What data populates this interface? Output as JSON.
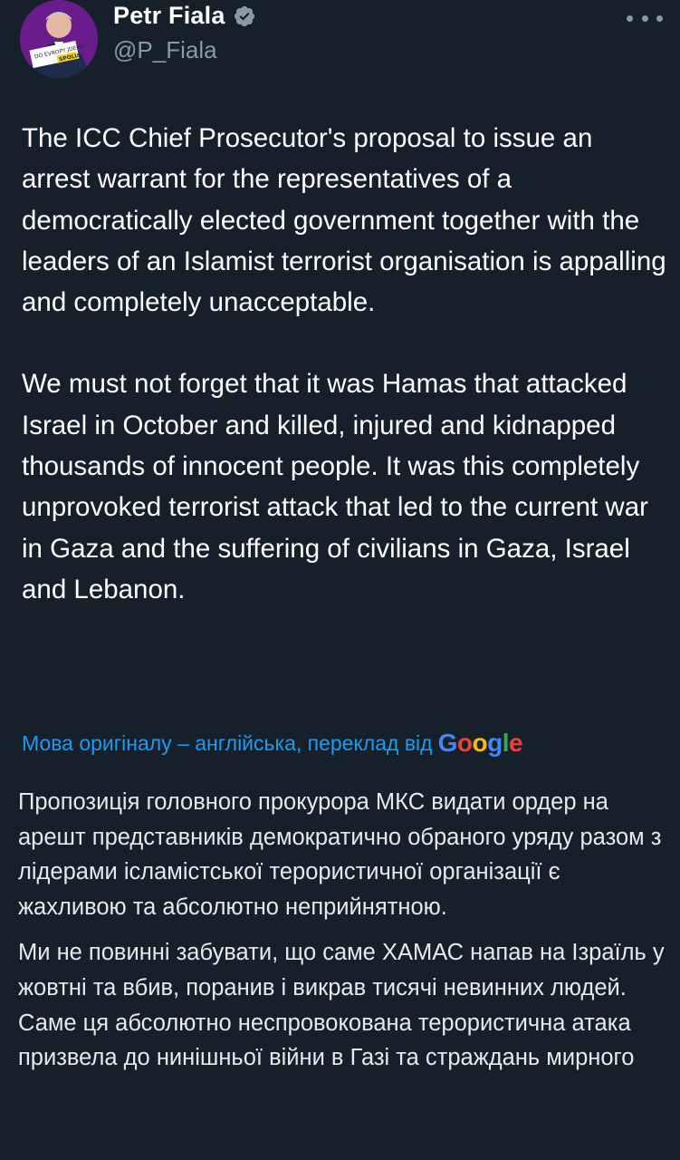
{
  "author": {
    "name": "Petr Fiala",
    "handle": "@P_Fiala",
    "verified": true,
    "avatar_badge_line1": "DO EVROPY JDEME",
    "avatar_badge_line2": "SPOLU"
  },
  "tweet": {
    "paragraph1": "The ICC Chief Prosecutor's proposal to issue an arrest warrant for the representatives of a democratically elected government together with the leaders of an Islamist terrorist organisation is appalling and completely unacceptable.",
    "paragraph2": "We must not forget that it was Hamas that attacked Israel in October and killed, injured and kidnapped thousands of innocent people. It was this completely unprovoked terrorist attack that led to the current war in Gaza and the suffering of civilians in Gaza, Israel and Lebanon."
  },
  "translation": {
    "notice": "Мова оригіналу – англійська, переклад від",
    "provider": "Google",
    "paragraph1": "Пропозиція головного прокурора МКС видати ордер на арешт представників демократично обраного уряду разом з лідерами ісламістської терористичної організації є жахливою та абсолютно неприйнятною.",
    "paragraph2": "Ми не повинні забувати, що саме ХАМАС напав на Ізраїль у жовтні та вбив, поранив і викрав тисячі невинних людей. Саме ця абсолютно неспровокована терористична атака призвела до нинішньої війни в Газі та страждань мирного"
  },
  "colors": {
    "background": "#15202b",
    "text": "#ffffff",
    "secondary": "#8b98a5",
    "link": "#1d9bf0",
    "verified": "#8b98a5"
  },
  "icons": {
    "verified": "verified-badge-icon",
    "more": "more-options-icon"
  }
}
